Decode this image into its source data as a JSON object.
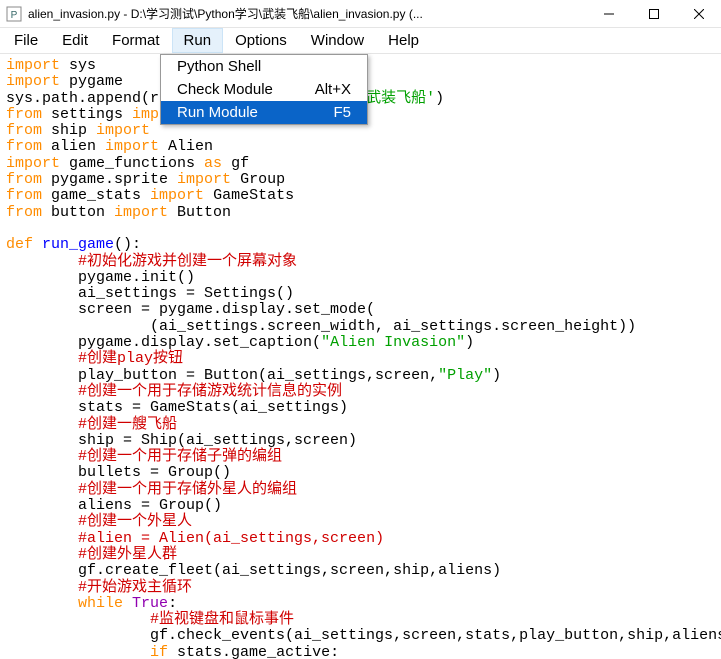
{
  "window": {
    "title": "alien_invasion.py - D:\\学习测试\\Python学习\\武装飞船\\alien_invasion.py (..."
  },
  "menubar": {
    "items": [
      "File",
      "Edit",
      "Format",
      "Run",
      "Options",
      "Window",
      "Help"
    ],
    "open_index": 3
  },
  "dropdown": {
    "items": [
      {
        "label": "Python Shell",
        "shortcut": ""
      },
      {
        "label": "Check Module",
        "shortcut": "Alt+X"
      },
      {
        "label": "Run Module",
        "shortcut": "F5"
      }
    ],
    "highlight_index": 2
  },
  "code": {
    "lines": [
      [
        {
          "t": "import",
          "c": "kw"
        },
        {
          "t": " sys",
          "c": "ident"
        }
      ],
      [
        {
          "t": "import",
          "c": "kw"
        },
        {
          "t": " pygame",
          "c": "ident"
        }
      ],
      [
        {
          "t": "sys.path.append(r",
          "c": "ident"
        },
        {
          "t": "",
          "c": "str"
        },
        {
          "t": "                       ",
          "c": "ident"
        },
        {
          "t": "武装飞船'",
          "c": "str"
        },
        {
          "t": ")",
          "c": "ident"
        }
      ],
      [
        {
          "t": "from",
          "c": "kw"
        },
        {
          "t": " settings ",
          "c": "ident"
        },
        {
          "t": "imp",
          "c": "kw"
        }
      ],
      [
        {
          "t": "from",
          "c": "kw"
        },
        {
          "t": " ship ",
          "c": "ident"
        },
        {
          "t": "import",
          "c": "kw"
        }
      ],
      [
        {
          "t": "from",
          "c": "kw"
        },
        {
          "t": " alien ",
          "c": "ident"
        },
        {
          "t": "import",
          "c": "kw"
        },
        {
          "t": " Alien",
          "c": "ident"
        }
      ],
      [
        {
          "t": "import",
          "c": "kw"
        },
        {
          "t": " game_functions ",
          "c": "ident"
        },
        {
          "t": "as",
          "c": "kw"
        },
        {
          "t": " gf",
          "c": "ident"
        }
      ],
      [
        {
          "t": "from",
          "c": "kw"
        },
        {
          "t": " pygame.sprite ",
          "c": "ident"
        },
        {
          "t": "import",
          "c": "kw"
        },
        {
          "t": " Group",
          "c": "ident"
        }
      ],
      [
        {
          "t": "from",
          "c": "kw"
        },
        {
          "t": " game_stats ",
          "c": "ident"
        },
        {
          "t": "import",
          "c": "kw"
        },
        {
          "t": " GameStats",
          "c": "ident"
        }
      ],
      [
        {
          "t": "from",
          "c": "kw"
        },
        {
          "t": " button ",
          "c": "ident"
        },
        {
          "t": "import",
          "c": "kw"
        },
        {
          "t": " Button",
          "c": "ident"
        }
      ],
      [],
      [
        {
          "t": "def",
          "c": "kw"
        },
        {
          "t": " ",
          "c": "ident"
        },
        {
          "t": "run_game",
          "c": "blue"
        },
        {
          "t": "():",
          "c": "ident"
        }
      ],
      [
        {
          "t": "        ",
          "c": "ident"
        },
        {
          "t": "#初始化游戏并创建一个屏幕对象",
          "c": "comm"
        }
      ],
      [
        {
          "t": "        pygame.init()",
          "c": "ident"
        }
      ],
      [
        {
          "t": "        ai_settings = Settings()",
          "c": "ident"
        }
      ],
      [
        {
          "t": "        screen = pygame.display.set_mode(",
          "c": "ident"
        }
      ],
      [
        {
          "t": "                (ai_settings.screen_width, ai_settings.screen_height))",
          "c": "ident"
        }
      ],
      [
        {
          "t": "        pygame.display.set_caption(",
          "c": "ident"
        },
        {
          "t": "\"Alien Invasion\"",
          "c": "str"
        },
        {
          "t": ")",
          "c": "ident"
        }
      ],
      [
        {
          "t": "        ",
          "c": "ident"
        },
        {
          "t": "#创建play按钮",
          "c": "comm"
        }
      ],
      [
        {
          "t": "        play_button = Button(ai_settings,screen,",
          "c": "ident"
        },
        {
          "t": "\"Play\"",
          "c": "str"
        },
        {
          "t": ")",
          "c": "ident"
        }
      ],
      [
        {
          "t": "        ",
          "c": "ident"
        },
        {
          "t": "#创建一个用于存储游戏统计信息的实例",
          "c": "comm"
        }
      ],
      [
        {
          "t": "        stats = GameStats(ai_settings)",
          "c": "ident"
        }
      ],
      [
        {
          "t": "        ",
          "c": "ident"
        },
        {
          "t": "#创建一艘飞船",
          "c": "comm"
        }
      ],
      [
        {
          "t": "        ship = Ship(ai_settings,screen)",
          "c": "ident"
        }
      ],
      [
        {
          "t": "        ",
          "c": "ident"
        },
        {
          "t": "#创建一个用于存储子弹的编组",
          "c": "comm"
        }
      ],
      [
        {
          "t": "        bullets = Group()",
          "c": "ident"
        }
      ],
      [
        {
          "t": "        ",
          "c": "ident"
        },
        {
          "t": "#创建一个用于存储外星人的编组",
          "c": "comm"
        }
      ],
      [
        {
          "t": "        aliens = Group()",
          "c": "ident"
        }
      ],
      [
        {
          "t": "        ",
          "c": "ident"
        },
        {
          "t": "#创建一个外星人",
          "c": "comm"
        }
      ],
      [
        {
          "t": "        ",
          "c": "ident"
        },
        {
          "t": "#alien = Alien(ai_settings,screen)",
          "c": "comm"
        }
      ],
      [
        {
          "t": "        ",
          "c": "ident"
        },
        {
          "t": "#创建外星人群",
          "c": "comm"
        }
      ],
      [
        {
          "t": "        gf.create_fleet(ai_settings,screen,ship,aliens)",
          "c": "ident"
        }
      ],
      [
        {
          "t": "        ",
          "c": "ident"
        },
        {
          "t": "#开始游戏主循环",
          "c": "comm"
        }
      ],
      [
        {
          "t": "        ",
          "c": "ident"
        },
        {
          "t": "while",
          "c": "kw"
        },
        {
          "t": " ",
          "c": "ident"
        },
        {
          "t": "True",
          "c": "purple"
        },
        {
          "t": ":",
          "c": "ident"
        }
      ],
      [
        {
          "t": "                ",
          "c": "ident"
        },
        {
          "t": "#监视键盘和鼠标事件",
          "c": "comm"
        }
      ],
      [
        {
          "t": "                gf.check_events(ai_settings,screen,stats,play_button,ship,aliens",
          "c": "ident"
        }
      ],
      [
        {
          "t": "                ",
          "c": "ident"
        },
        {
          "t": "if",
          "c": "kw"
        },
        {
          "t": " stats.game_active:",
          "c": "ident"
        }
      ]
    ]
  }
}
